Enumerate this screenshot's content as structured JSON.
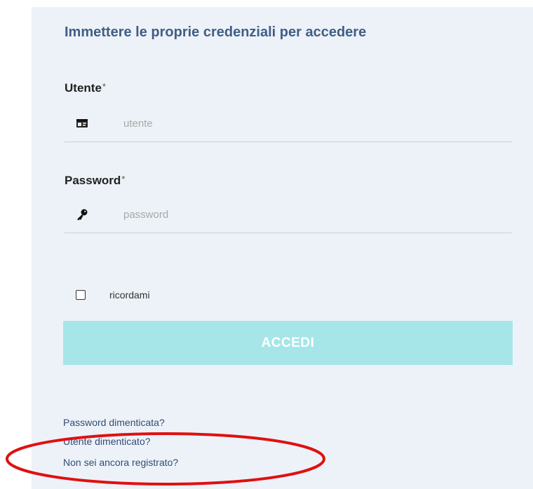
{
  "form": {
    "heading": "Immettere le proprie credenziali per accedere",
    "username": {
      "label": "Utente",
      "required_mark": "*",
      "placeholder": "utente",
      "value": "",
      "icon": "id-card-icon"
    },
    "password": {
      "label": "Password",
      "required_mark": "*",
      "placeholder": "password",
      "value": "",
      "icon": "key-icon"
    },
    "remember": {
      "label": "ricordami",
      "checked": false
    },
    "submit_label": "ACCEDI"
  },
  "links": {
    "forgot_password": "Password dimenticata?",
    "forgot_username": "Utente dimenticato?",
    "register": "Non sei ancora registrato?"
  },
  "colors": {
    "panel_background": "#edf2f8",
    "heading": "#3f5f86",
    "button_background": "#a6e6e9",
    "button_text": "#ffffff",
    "link": "#2f4d75",
    "annotation_ellipse": "#e01010"
  }
}
